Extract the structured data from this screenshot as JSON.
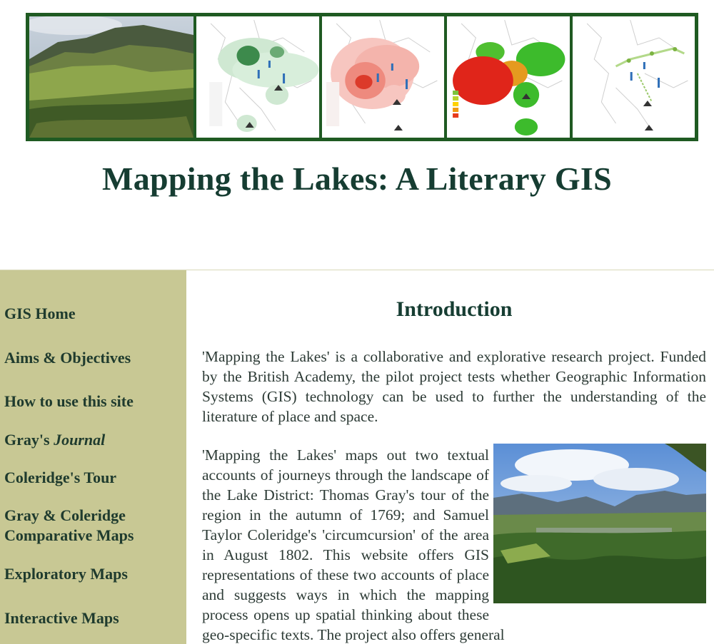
{
  "site_title": "Mapping the Lakes: A Literary GIS",
  "banner": {
    "panels": [
      {
        "name": "fell-landscape-photo"
      },
      {
        "name": "green-density-map"
      },
      {
        "name": "red-density-map"
      },
      {
        "name": "mentions-percentage-map"
      },
      {
        "name": "route-comparison-map"
      }
    ]
  },
  "sidebar": {
    "items": [
      {
        "label": "GIS Home"
      },
      {
        "label": "Aims & Objectives"
      },
      {
        "label": "How to use this site"
      },
      {
        "label_prefix": "Gray's ",
        "label_italic": "Journal"
      },
      {
        "label": "Coleridge's Tour"
      },
      {
        "label_line1": "Gray & Coleridge",
        "label_line2": "Comparative Maps"
      },
      {
        "label": "Exploratory Maps"
      },
      {
        "label": "Interactive Maps"
      }
    ]
  },
  "main": {
    "heading": "Introduction",
    "paragraph1": "'Mapping the Lakes' is a collaborative and explorative research project. Funded by the British Academy, the pilot project tests whether Geographic Information Systems (GIS) technology can be used to further the understanding of the literature of place and space.",
    "paragraph2": "'Mapping the Lakes' maps out two textual accounts of journeys through the landscape of the Lake District: Thomas Gray's tour of the region in the autumn of 1769; and Samuel Taylor Coleridge's 'circumcursion' of the area in August 1802. This website offers GIS representations of these two accounts of place and suggests ways in which the mapping process opens up spatial thinking about these geo-specific texts. The project also offers general"
  },
  "colors": {
    "banner_border": "#1f5a22",
    "sidebar_bg": "#c8c894",
    "title_text": "#163d32",
    "nav_text": "#1f3b2e"
  }
}
